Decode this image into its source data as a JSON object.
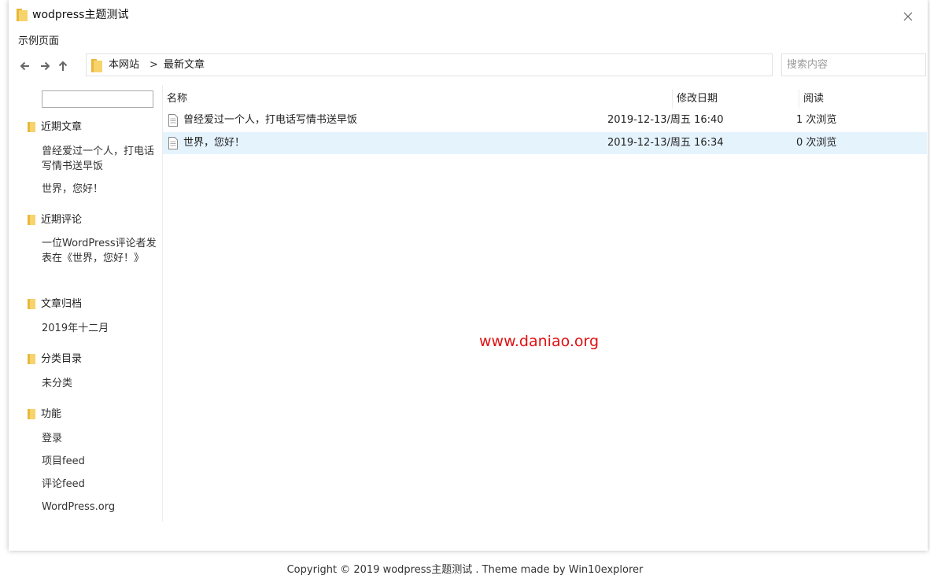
{
  "window": {
    "title": "wodpress主题测试",
    "menu_label": "示例页面"
  },
  "icons": {
    "folder_color": "#f7d36b",
    "folder_tab_color": "#e8b83b",
    "back": "arrow-left-icon",
    "forward": "arrow-right-icon",
    "up": "arrow-up-icon",
    "close": "close-icon",
    "file": "document-icon"
  },
  "breadcrumb": {
    "root": "本网站",
    "separator": ">",
    "current": "最新文章"
  },
  "search": {
    "placeholder": "搜索内容"
  },
  "sidebar": {
    "sections": [
      {
        "heading": "近期文章",
        "links": [
          "曾经爱过一个人，打电话写情书送早饭",
          "世界，您好！"
        ]
      },
      {
        "heading": "近期评论",
        "links": [
          "一位WordPress评论者发表在《世界，您好！》"
        ]
      },
      {
        "heading": "文章归档",
        "links": [
          "2019年十二月"
        ]
      },
      {
        "heading": "分类目录",
        "links": [
          "未分类"
        ]
      },
      {
        "heading": "功能",
        "links": [
          "登录",
          "项目feed",
          "评论feed",
          "WordPress.org"
        ]
      }
    ]
  },
  "filelist": {
    "columns": {
      "name": "名称",
      "date": "修改日期",
      "views": "阅读"
    },
    "rows": [
      {
        "name": "曾经爱过一个人，打电话写情书送早饭",
        "date": "2019-12-13/周五 16:40",
        "views": "1 次浏览",
        "selected": false
      },
      {
        "name": "世界，您好！",
        "date": "2019-12-13/周五 16:34",
        "views": "0 次浏览",
        "selected": true
      }
    ],
    "selected_color": "#e5f3fd"
  },
  "watermark": {
    "text": "www.daniao.org",
    "color": "#e01010"
  },
  "footer": {
    "text": "Copyright © 2019 wodpress主题测试 . Theme made by Win10explorer"
  }
}
